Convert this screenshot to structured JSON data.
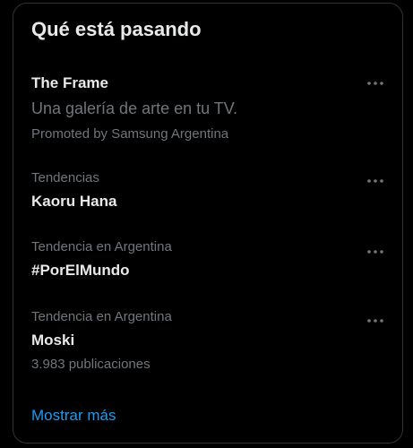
{
  "panel": {
    "title": "Qué está pasando",
    "accent_color": "#1d9bf0",
    "border_color": "#2f3336",
    "muted_color": "#71767b",
    "text_color": "#e7e9ea",
    "more_icon": "ellipsis-horizontal-icon",
    "show_more_label": "Mostrar más"
  },
  "promoted": {
    "name": "The Frame",
    "tagline": "Una galería de arte en tu TV.",
    "sponsor": "Promoted by Samsung Argentina"
  },
  "trends": [
    {
      "context": "Tendencias",
      "name": "Kaoru Hana",
      "count": ""
    },
    {
      "context": "Tendencia en Argentina",
      "name": "#PorElMundo",
      "count": ""
    },
    {
      "context": "Tendencia en Argentina",
      "name": "Moski",
      "count": "3.983 publicaciones"
    }
  ]
}
